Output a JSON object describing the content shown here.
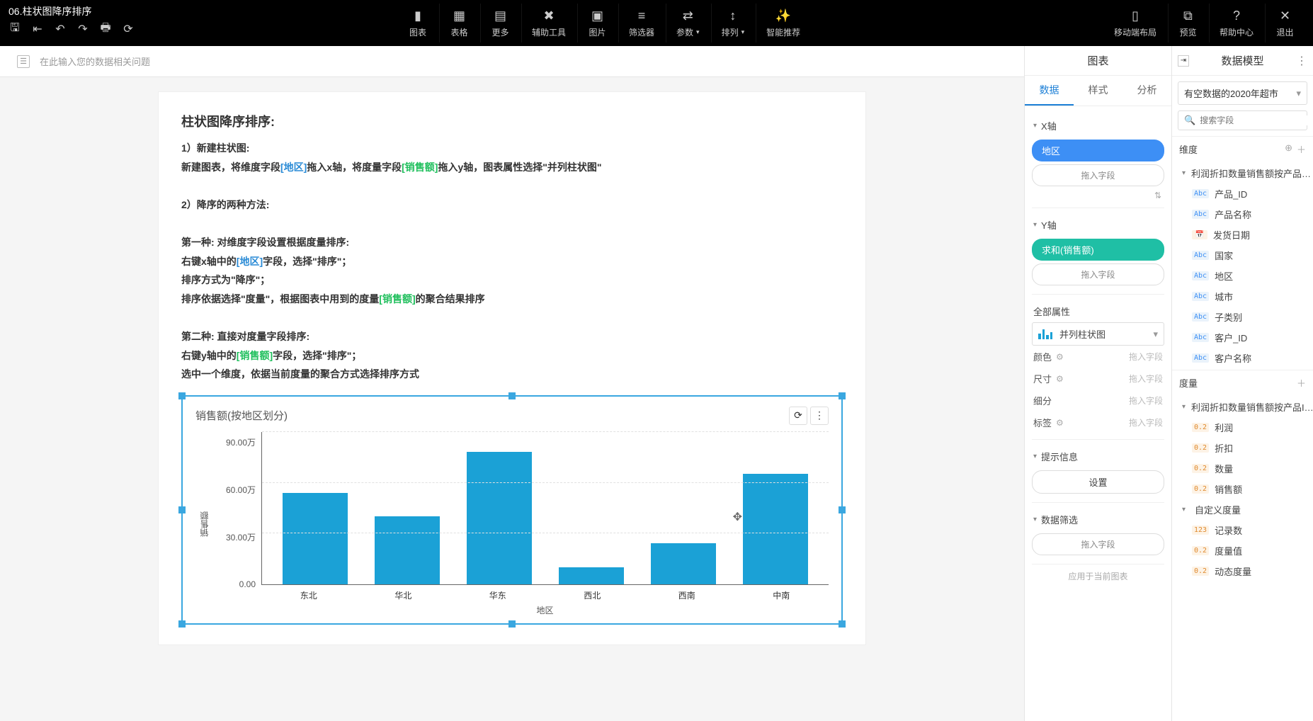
{
  "app": {
    "title": "06.柱状图降序排序"
  },
  "toolbar_left_icons": [
    "save-icon",
    "align-left-icon",
    "undo-icon",
    "redo-icon",
    "print-icon",
    "refresh-icon"
  ],
  "toolbar_center": [
    {
      "label": "图表",
      "icon": "chart-bar-icon"
    },
    {
      "label": "表格",
      "icon": "table-icon"
    },
    {
      "label": "更多",
      "icon": "grid-icon"
    },
    {
      "label": "辅助工具",
      "icon": "tools-icon"
    },
    {
      "label": "图片",
      "icon": "image-icon"
    },
    {
      "label": "筛选器",
      "icon": "filter-icon"
    },
    {
      "label": "参数",
      "icon": "param-icon",
      "caret": true
    },
    {
      "label": "排列",
      "icon": "sort-icon",
      "caret": true
    },
    {
      "label": "智能推荐",
      "icon": "magic-icon"
    }
  ],
  "toolbar_right": [
    {
      "label": "移动端布局",
      "icon": "mobile-icon"
    },
    {
      "label": "预览",
      "icon": "preview-icon"
    },
    {
      "label": "帮助中心",
      "icon": "help-icon"
    },
    {
      "label": "退出",
      "icon": "exit-icon"
    }
  ],
  "askbar": {
    "placeholder": "在此输入您的数据相关问题"
  },
  "doc": {
    "h1": "柱状图降序排序:",
    "l1_a": "1）新建柱状图:",
    "l1_b_pre": "新建图表，将维度字段",
    "l1_b_dim": "[地区]",
    "l1_b_mid": "拖入x轴，将度量字段",
    "l1_b_meas": "[销售额]",
    "l1_b_post": "拖入y轴，图表属性选择\"并列柱状图\"",
    "l2": "2）降序的两种方法:",
    "m1_h": "第一种: 对维度字段设置根据度量排序:",
    "m1_a_pre": "右键x轴中的",
    "m1_a_dim": "[地区]",
    "m1_a_post": "字段，选择\"排序\"；",
    "m1_b": "排序方式为\"降序\"；",
    "m1_c_pre": "排序依据选择\"度量\"，根据图表中用到的度量",
    "m1_c_meas": "[销售额]",
    "m1_c_post": "的聚合结果排序",
    "m2_h": "第二种: 直接对度量字段排序:",
    "m2_a_pre": "右键y轴中的",
    "m2_a_meas": "[销售额]",
    "m2_a_post": "字段，选择\"排序\"；",
    "m2_b": "选中一个维度，依据当前度量的聚合方式选择排序方式"
  },
  "chart_data": {
    "type": "bar",
    "title": "销售额(按地区划分)",
    "xlabel": "地区",
    "ylabel": "销售额",
    "yticks": [
      "90.00万",
      "60.00万",
      "30.00万",
      "0.00"
    ],
    "ylim_wan": [
      0,
      90
    ],
    "categories": [
      "东北",
      "华北",
      "华东",
      "西北",
      "西南",
      "中南"
    ],
    "values_wan": [
      54,
      40,
      78,
      10,
      24,
      65
    ]
  },
  "config": {
    "title": "图表",
    "tabs": {
      "data": "数据",
      "style": "样式",
      "analysis": "分析"
    },
    "xaxis": {
      "label": "X轴",
      "field": "地区",
      "drop": "拖入字段"
    },
    "yaxis": {
      "label": "Y轴",
      "field": "求和(销售额)",
      "drop": "拖入字段"
    },
    "all_props": "全部属性",
    "chart_type": "并列柱状图",
    "props": {
      "color": "颜色",
      "size": "尺寸",
      "detail": "细分",
      "label": "标签",
      "ph": "拖入字段"
    },
    "hint": {
      "label": "提示信息",
      "btn": "设置"
    },
    "filter": {
      "label": "数据筛选",
      "drop": "拖入字段"
    },
    "apply": "应用于当前图表"
  },
  "model": {
    "title": "数据模型",
    "datasource": "有空数据的2020年超市",
    "search_ph": "搜索字段",
    "dim_label": "维度",
    "meas_label": "度量",
    "dim_group": "利润折扣数量销售额按产品…",
    "dims": [
      {
        "t": "Abc",
        "n": "产品_ID"
      },
      {
        "t": "Abc",
        "n": "产品名称"
      },
      {
        "t": "date",
        "n": "发货日期"
      },
      {
        "t": "Abc",
        "n": "国家"
      },
      {
        "t": "Abc",
        "n": "地区"
      },
      {
        "t": "Abc",
        "n": "城市"
      },
      {
        "t": "Abc",
        "n": "子类别"
      },
      {
        "t": "Abc",
        "n": "客户_ID"
      },
      {
        "t": "Abc",
        "n": "客户名称"
      }
    ],
    "meas_group": "利润折扣数量销售额按产品I…",
    "meas": [
      {
        "t": "0.2",
        "n": "利润"
      },
      {
        "t": "0.2",
        "n": "折扣"
      },
      {
        "t": "0.2",
        "n": "数量"
      },
      {
        "t": "0.2",
        "n": "销售额"
      }
    ],
    "custom_label": "自定义度量",
    "custom": [
      {
        "t": "123",
        "n": "记录数"
      },
      {
        "t": "0.2",
        "n": "度量值"
      },
      {
        "t": "0.2",
        "n": "动态度量"
      }
    ]
  },
  "icon_glyph": {
    "save-icon": "🖫",
    "align-left-icon": "⇤",
    "undo-icon": "↶",
    "redo-icon": "↷",
    "print-icon": "🖶",
    "refresh-icon": "⟳",
    "chart-bar-icon": "▮",
    "table-icon": "▦",
    "grid-icon": "▤",
    "tools-icon": "✖",
    "image-icon": "▣",
    "filter-icon": "≡",
    "param-icon": "⇄",
    "sort-icon": "↕",
    "magic-icon": "✨",
    "mobile-icon": "▯",
    "preview-icon": "⧉",
    "help-icon": "?",
    "exit-icon": "✕",
    "more-icon": "⋮",
    "reload-icon": "⟳",
    "gear-icon": "⚙",
    "search-icon": "🔍",
    "globe-icon": "⊕",
    "plus-icon": "＋",
    "calendar-icon": "📅",
    "collapse-icon": "⇥"
  }
}
